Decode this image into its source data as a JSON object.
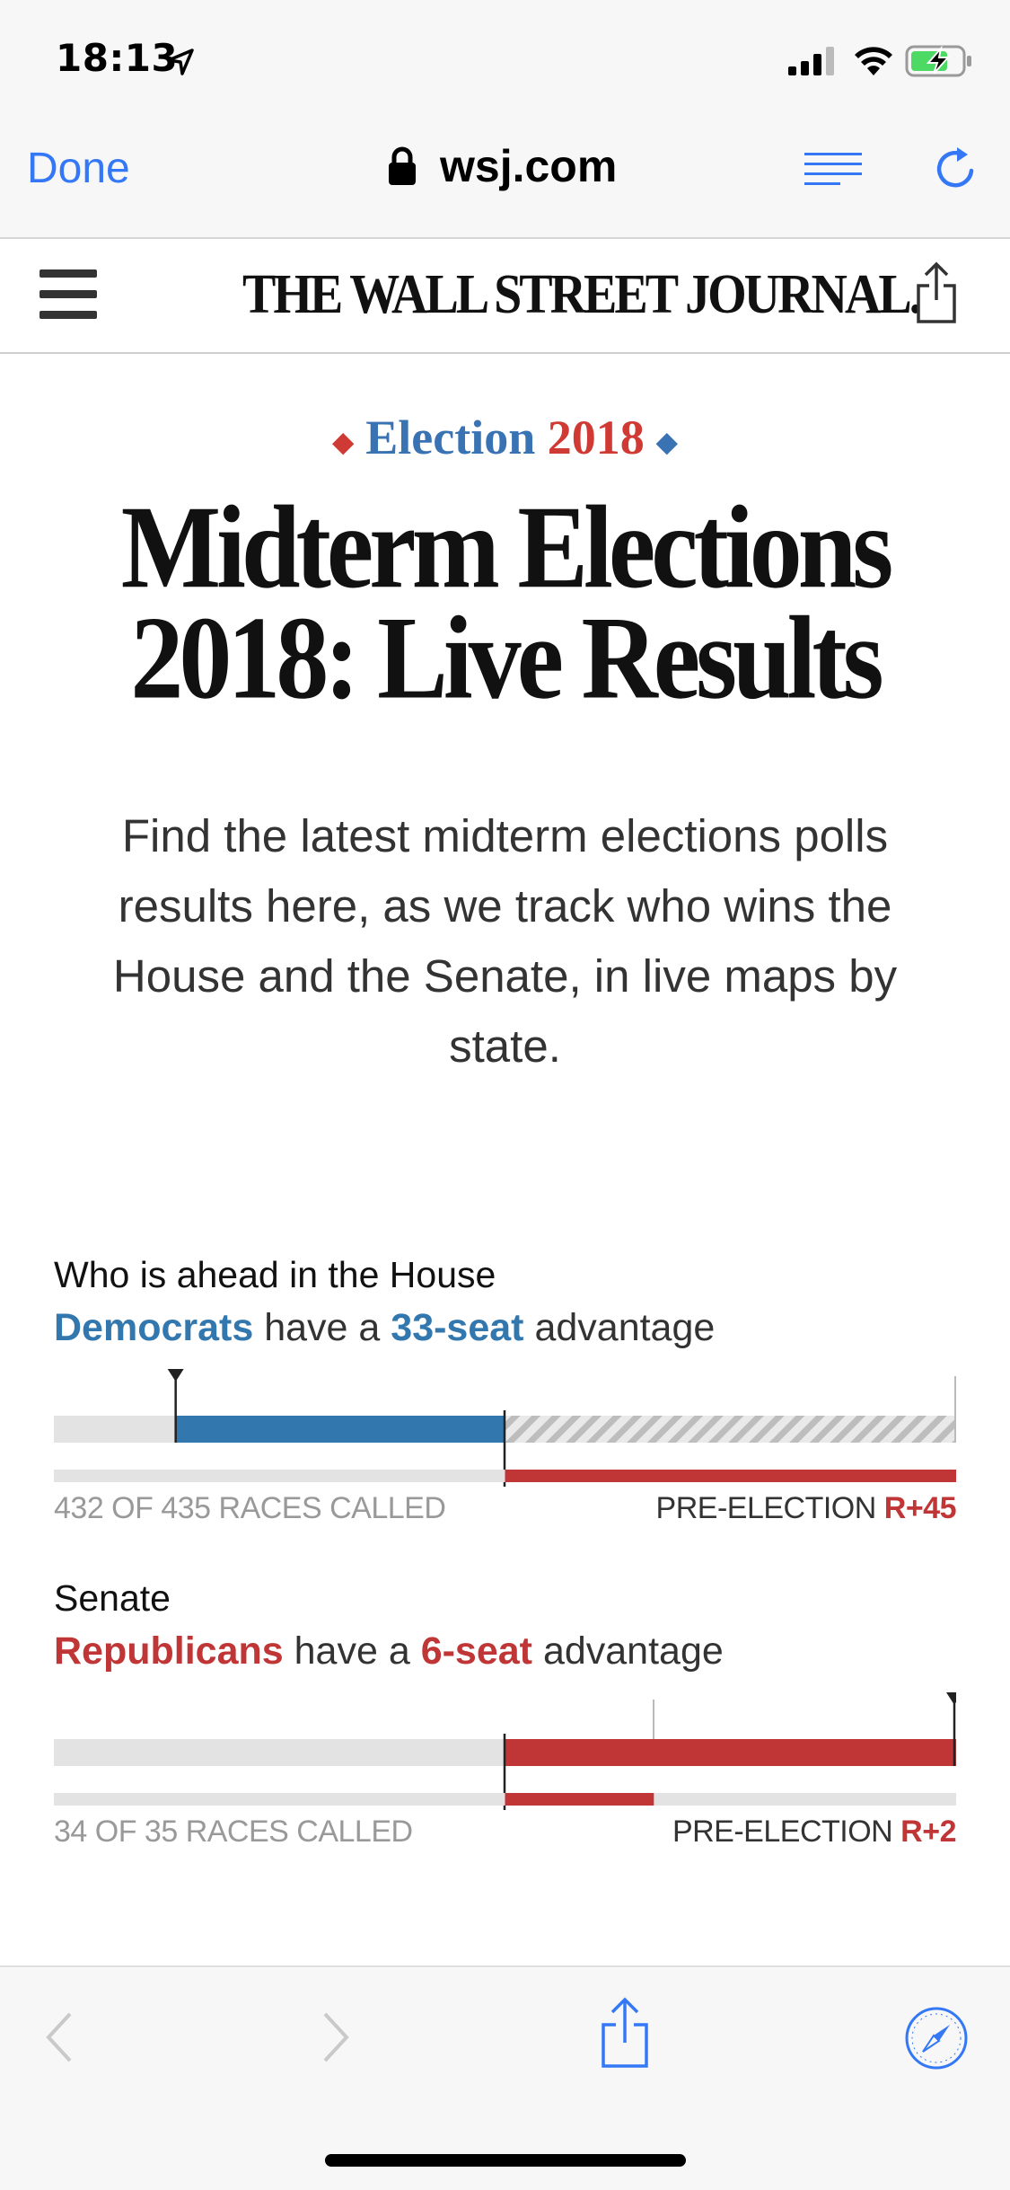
{
  "status": {
    "time": "18:13"
  },
  "browser": {
    "done_label": "Done",
    "url": "wsj.com"
  },
  "site": {
    "masthead": "THE WALL STREET JOURNAL."
  },
  "article": {
    "kicker_word": "Election",
    "kicker_year": "2018",
    "headline": "Midterm Elections 2018: Live Results",
    "dek": "Find the latest midterm elections polls results here, as we track who wins the House and the Senate, in live maps by state."
  },
  "house": {
    "title": "Who is ahead in the House",
    "party": "Democrats",
    "middle": "have a",
    "seats": "33-seat",
    "tail": "advantage",
    "called": "432 OF 435 RACES CALLED",
    "pre_label": "PRE-ELECTION",
    "pre_value": "R+45",
    "bar": {
      "dem_from": 0.135,
      "dem_to": 0.5,
      "rep_to": 1.0,
      "pre_rep_from": 0.5,
      "pre_rep_to": 1.0
    }
  },
  "senate": {
    "title": "Senate",
    "party": "Republicans",
    "middle": "have a",
    "seats": "6-seat",
    "tail": "advantage",
    "called": "34 OF 35 RACES CALLED",
    "pre_label": "PRE-ELECTION",
    "pre_value": "R+2",
    "bar": {
      "rep_from": 0.5,
      "rep_to": 1.0,
      "pre_rep_from": 0.5,
      "pre_rep_to": 0.665
    }
  },
  "colors": {
    "democrat": "#3277ad",
    "republican": "#c03637",
    "track": "#e3e3e3",
    "link_blue": "#3478f6"
  },
  "icons": {
    "location": "location-arrow-icon",
    "lock": "lock-icon",
    "reader": "reader-view-icon",
    "reload": "reload-icon",
    "menu": "hamburger-menu-icon",
    "share": "share-icon",
    "back": "chevron-left-icon",
    "forward": "chevron-right-icon",
    "safari": "compass-icon"
  }
}
